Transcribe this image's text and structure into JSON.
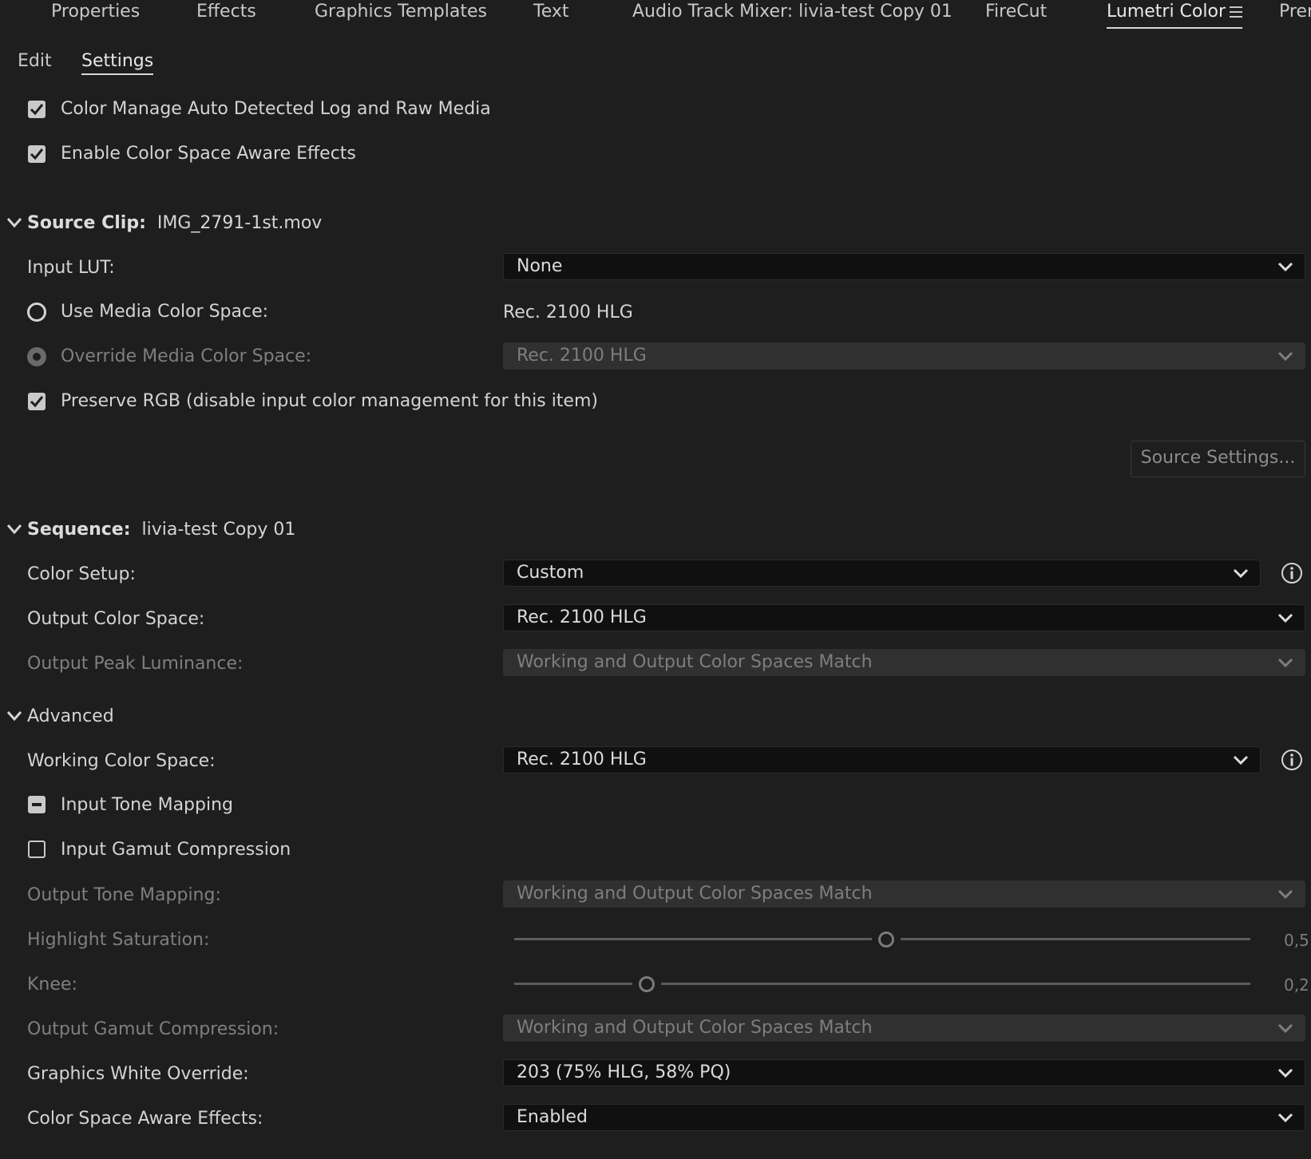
{
  "panel_tabs": [
    {
      "label": "Properties"
    },
    {
      "label": "Effects"
    },
    {
      "label": "Graphics Templates"
    },
    {
      "label": "Text"
    },
    {
      "label": "Audio Track Mixer: livia-test Copy 01"
    },
    {
      "label": "FireCut"
    },
    {
      "label": "Lumetri Color"
    },
    {
      "label": "Prer"
    }
  ],
  "sub_tabs": {
    "edit": "Edit",
    "settings": "Settings"
  },
  "global": {
    "color_manage": "Color Manage Auto Detected Log and Raw Media",
    "color_space_aware": "Enable Color Space Aware Effects"
  },
  "source_clip": {
    "heading": "Source Clip:",
    "clip_name": "IMG_2791-1st.mov",
    "input_lut_label": "Input LUT:",
    "input_lut_value": "None",
    "use_media_label": "Use Media Color Space:",
    "use_media_value": "Rec. 2100 HLG",
    "override_label": "Override Media Color Space:",
    "override_value": "Rec. 2100 HLG",
    "preserve_rgb_label": "Preserve RGB (disable input color management for this item)",
    "source_settings_button": "Source Settings..."
  },
  "sequence": {
    "heading": "Sequence:",
    "name": "livia-test Copy 01",
    "color_setup_label": "Color Setup:",
    "color_setup_value": "Custom",
    "output_color_space_label": "Output Color Space:",
    "output_color_space_value": "Rec. 2100 HLG",
    "output_peak_label": "Output Peak Luminance:",
    "output_peak_value": "Working and Output Color Spaces Match"
  },
  "advanced": {
    "heading": "Advanced",
    "working_color_space_label": "Working Color Space:",
    "working_color_space_value": "Rec. 2100 HLG",
    "input_tone_mapping_label": "Input Tone Mapping",
    "input_gamut_label": "Input Gamut Compression",
    "output_tone_mapping_label": "Output Tone Mapping:",
    "output_tone_mapping_value": "Working and Output Color Spaces Match",
    "highlight_sat_label": "Highlight Saturation:",
    "highlight_sat_value": "0,5",
    "knee_label": "Knee:",
    "knee_value": "0,2",
    "output_gamut_label": "Output Gamut Compression:",
    "output_gamut_value": "Working and Output Color Spaces Match",
    "graphics_white_label": "Graphics White Override:",
    "graphics_white_value": "203 (75% HLG, 58% PQ)",
    "csa_effects_label": "Color Space Aware Effects:",
    "csa_effects_value": "Enabled"
  },
  "colors": {
    "background": "#1e1e1e",
    "dropdown_bg": "#101010",
    "dropdown_disabled_bg": "#303030",
    "text": "#d4d4d4",
    "text_dim": "#7f7f7f"
  },
  "icons": {
    "menu": "hamburger-menu-icon",
    "chevron": "chevron-down-icon",
    "info": "info-icon",
    "check": "checkmark-icon"
  }
}
